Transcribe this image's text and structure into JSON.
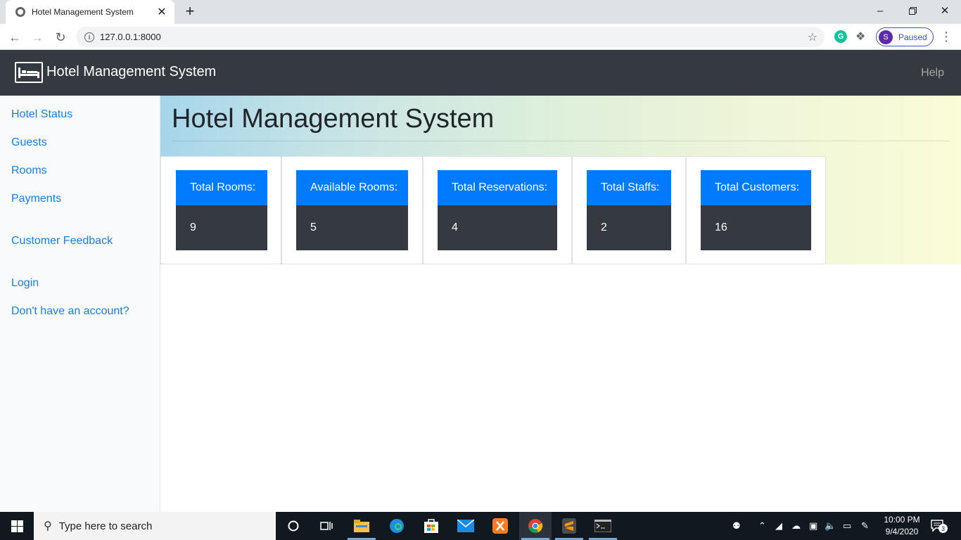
{
  "browser": {
    "tab_title": "Hotel Management System",
    "tab_close": "✕",
    "new_tab": "+",
    "url": "127.0.0.1:8000",
    "profile_initial": "S",
    "profile_status": "Paused",
    "ext_letter": "G"
  },
  "navbar": {
    "brand": "Hotel Management System",
    "help": "Help"
  },
  "sidebar": {
    "items": [
      {
        "label": "Hotel Status"
      },
      {
        "label": "Guests"
      },
      {
        "label": "Rooms"
      },
      {
        "label": "Payments"
      },
      {
        "label": "Customer Feedback"
      },
      {
        "label": "Login"
      },
      {
        "label": "Don't have an account?"
      }
    ]
  },
  "main": {
    "title": "Hotel Management System",
    "cards": [
      {
        "label": "Total Rooms:",
        "value": "9"
      },
      {
        "label": "Available Rooms:",
        "value": "5"
      },
      {
        "label": "Total Reservations:",
        "value": "4"
      },
      {
        "label": "Total Staffs:",
        "value": "2"
      },
      {
        "label": "Total Customers:",
        "value": "16"
      }
    ]
  },
  "taskbar": {
    "search_placeholder": "Type here to search",
    "time": "10:00 PM",
    "date": "9/4/2020",
    "notification_count": "3"
  },
  "colors": {
    "navbar_bg": "#343a40",
    "card_header": "#007bff",
    "card_value": "#343a40",
    "link": "#1b7fd9"
  }
}
